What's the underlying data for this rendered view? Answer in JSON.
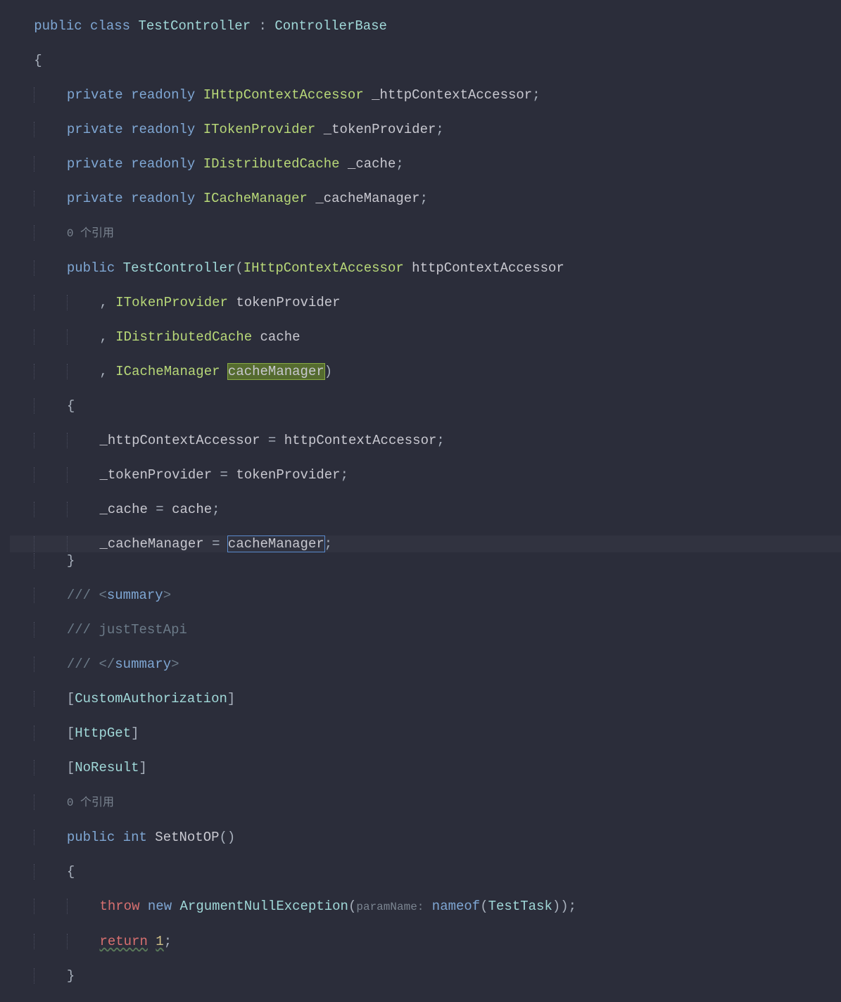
{
  "code": {
    "line1": {
      "public": "public",
      "class": "class",
      "name": "TestController",
      "colon": ":",
      "base": "ControllerBase"
    },
    "line2": {
      "brace": "{"
    },
    "line3": {
      "private": "private",
      "readonly": "readonly",
      "type": "IHttpContextAccessor",
      "field": "_httpContextAccessor",
      "semi": ";"
    },
    "line4": {
      "private": "private",
      "readonly": "readonly",
      "type": "ITokenProvider",
      "field": "_tokenProvider",
      "semi": ";"
    },
    "line5": {
      "private": "private",
      "readonly": "readonly",
      "type": "IDistributedCache",
      "field": "_cache",
      "semi": ";"
    },
    "line6": {
      "private": "private",
      "readonly": "readonly",
      "type": "ICacheManager",
      "field": "_cacheManager",
      "semi": ";"
    },
    "line7": {
      "refs": "0 个引用"
    },
    "line8": {
      "public": "public",
      "ctor": "TestController",
      "lparen": "(",
      "type1": "IHttpContextAccessor",
      "param1": "httpContextAccessor"
    },
    "line9": {
      "comma": ",",
      "type": "ITokenProvider",
      "param": "tokenProvider"
    },
    "line10": {
      "comma": ",",
      "type": "IDistributedCache",
      "param": "cache"
    },
    "line11": {
      "comma": ",",
      "type": "ICacheManager",
      "param": "cacheManager",
      "rparen": ")"
    },
    "line12": {
      "brace": "{"
    },
    "line13": {
      "field": "_httpContextAccessor",
      "eq": "=",
      "param": "httpContextAccessor",
      "semi": ";"
    },
    "line14": {
      "field": "_tokenProvider",
      "eq": "=",
      "param": "tokenProvider",
      "semi": ";"
    },
    "line15": {
      "field": "_cache",
      "eq": "=",
      "param": "cache",
      "semi": ";"
    },
    "line16": {
      "field": "_cacheManager",
      "eq": "=",
      "param": "cacheManager",
      "semi": ";"
    },
    "line17": {
      "brace": "}"
    },
    "line18": {
      "slashes": "///",
      "txt": "<summary>"
    },
    "line19": {
      "slashes": "///",
      "txt": " justTestApi"
    },
    "line20": {
      "slashes": "///",
      "txt": "</summary>"
    },
    "line21": {
      "lb": "[",
      "attr": "CustomAuthorization",
      "rb": "]"
    },
    "line22": {
      "lb": "[",
      "attr": "HttpGet",
      "rb": "]"
    },
    "line23": {
      "lb": "[",
      "attr": "NoResult",
      "rb": "]"
    },
    "line24": {
      "refs": "0 个引用"
    },
    "line25": {
      "public": "public",
      "int": "int",
      "name": "SetNotOP",
      "parens": "()"
    },
    "line26": {
      "brace": "{"
    },
    "line27": {
      "throw": "throw",
      "new": "new",
      "exc": "ArgumentNullException",
      "lparen": "(",
      "hint": "paramName:",
      "nameof": "nameof",
      "lparen2": "(",
      "arg": "TestTask",
      "rparen2": ")",
      "rparen": ")",
      "semi": ";"
    },
    "line28": {
      "return": "return",
      "num": "1",
      "semi": ";"
    },
    "line29": {
      "brace": "}"
    }
  }
}
